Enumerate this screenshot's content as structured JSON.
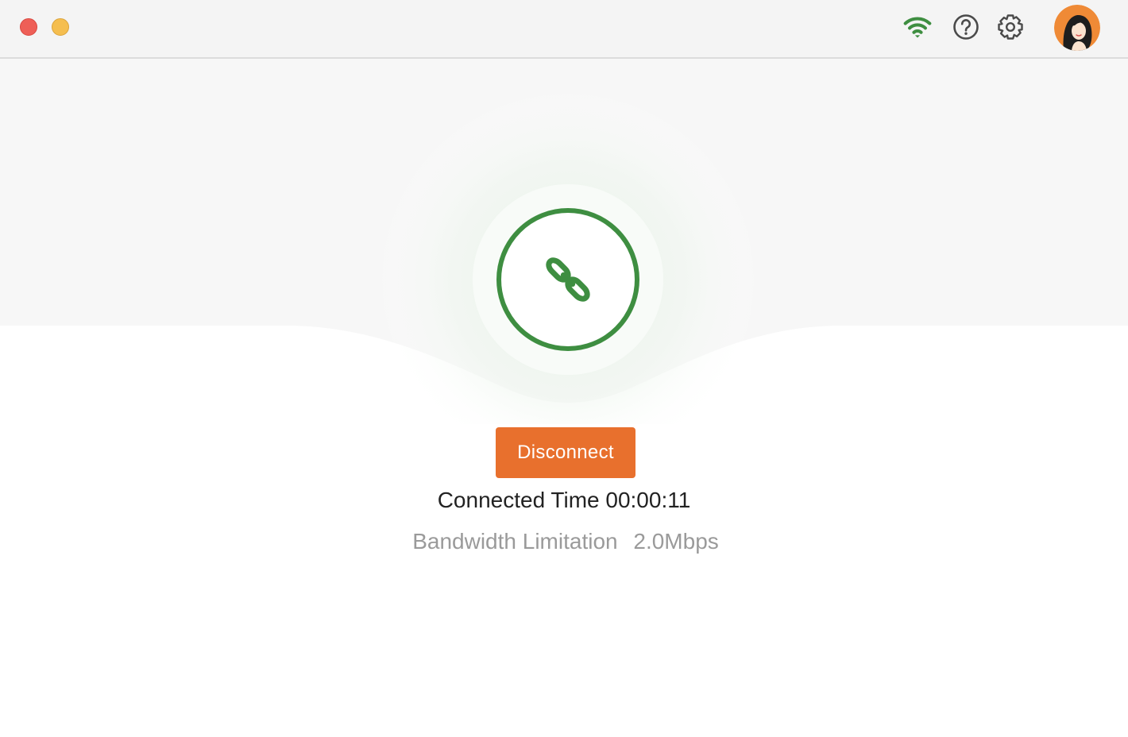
{
  "window": {
    "traffic_lights": [
      "close",
      "minimize"
    ]
  },
  "toolbar": {
    "icons": [
      {
        "name": "wifi-icon",
        "color": "#3e8e41"
      },
      {
        "name": "help-icon",
        "color": "#4a4a4a"
      },
      {
        "name": "gear-icon",
        "color": "#4a4a4a"
      }
    ],
    "avatar": {
      "name": "user-avatar",
      "color": "#ef8a36"
    }
  },
  "connection": {
    "status_icon": "link-icon",
    "accent_color": "#3e8e41",
    "disconnect_label": "Disconnect",
    "connected_time_label": "Connected Time",
    "connected_time_value": "00:00:11",
    "bandwidth_label": "Bandwidth Limitation",
    "bandwidth_value": "2.0Mbps"
  },
  "colors": {
    "button": "#e8702d",
    "background_top": "#f7f7f7"
  }
}
